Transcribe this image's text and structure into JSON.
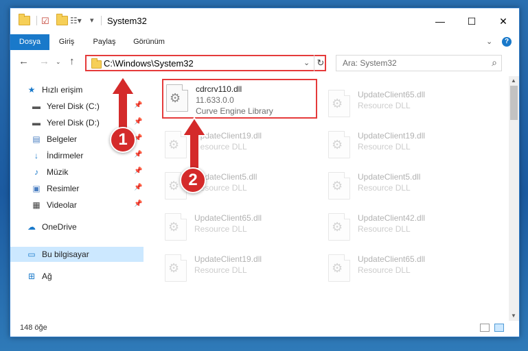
{
  "window": {
    "title": "System32",
    "controls": {
      "minimize": "—",
      "maximize": "☐",
      "close": "✕"
    }
  },
  "ribbon": {
    "tabs": [
      {
        "label": "Dosya",
        "active": true
      },
      {
        "label": "Giriş"
      },
      {
        "label": "Paylaş"
      },
      {
        "label": "Görünüm"
      }
    ],
    "help": "?"
  },
  "nav": {
    "back": "←",
    "forward": "→",
    "up": "↑",
    "address": "C:\\Windows\\System32",
    "search_placeholder": "Ara: System32"
  },
  "sidebar": {
    "items": [
      {
        "label": "Hızlı erişim",
        "icon": "star-icon"
      },
      {
        "label": "Yerel Disk (C:)",
        "icon": "drive-icon",
        "pinned": true
      },
      {
        "label": "Yerel Disk (D:)",
        "icon": "drive-icon",
        "pinned": true
      },
      {
        "label": "Belgeler",
        "icon": "documents-icon",
        "pinned": true
      },
      {
        "label": "İndirmeler",
        "icon": "download-icon",
        "pinned": true
      },
      {
        "label": "Müzik",
        "icon": "music-icon",
        "pinned": true
      },
      {
        "label": "Resimler",
        "icon": "pictures-icon",
        "pinned": true
      },
      {
        "label": "Videolar",
        "icon": "videos-icon",
        "pinned": true
      },
      {
        "label": "OneDrive",
        "icon": "cloud-icon"
      },
      {
        "label": "Bu bilgisayar",
        "icon": "computer-icon",
        "selected": true
      },
      {
        "label": "Ağ",
        "icon": "network-icon"
      }
    ]
  },
  "files": {
    "highlighted": {
      "name": "cdrcrv110.dll",
      "version": "11.633.0.0",
      "desc": "Curve Engine Library"
    },
    "left": [
      {
        "name": "UpdateClient19.dll",
        "desc": "Resource DLL"
      },
      {
        "name": "UpdateClient5.dll",
        "desc": "Resource DLL"
      },
      {
        "name": "UpdateClient65.dll",
        "desc": "Resource DLL"
      },
      {
        "name": "UpdateClient19.dll",
        "desc": "Resource DLL"
      }
    ],
    "right": [
      {
        "name": "UpdateClient65.dll",
        "desc": "Resource DLL"
      },
      {
        "name": "UpdateClient19.dll",
        "desc": "Resource DLL"
      },
      {
        "name": "UpdateClient5.dll",
        "desc": "Resource DLL"
      },
      {
        "name": "UpdateClient42.dll",
        "desc": "Resource DLL"
      },
      {
        "name": "UpdateClient65.dll",
        "desc": "Resource DLL"
      }
    ]
  },
  "status": {
    "count": "148 öğe"
  },
  "annotations": {
    "one": "1",
    "two": "2"
  },
  "colors": {
    "accent": "#1979ca",
    "highlight": "#e53a3a",
    "arrow": "#d42a2a"
  }
}
